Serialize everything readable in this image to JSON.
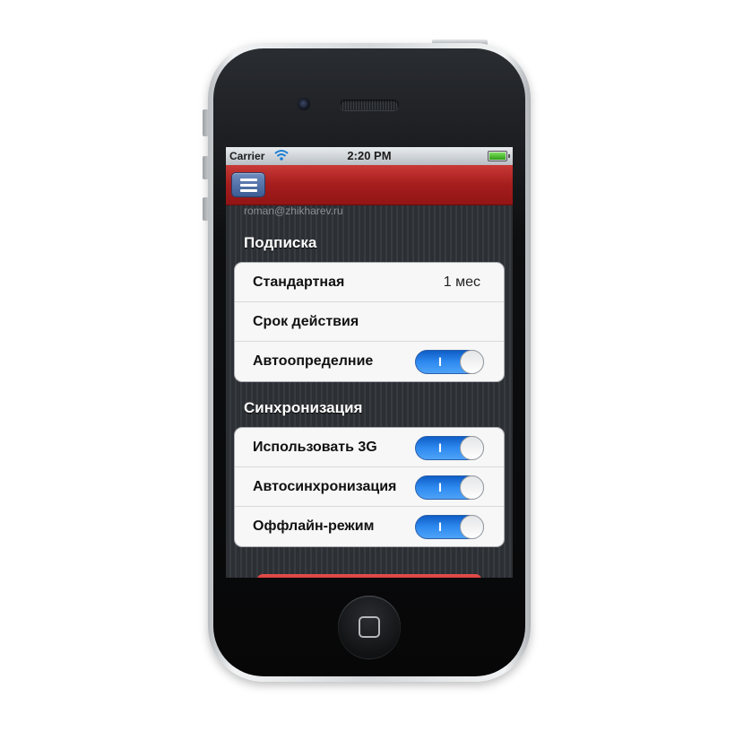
{
  "statusbar": {
    "carrier": "Carrier",
    "time": "2:20 PM"
  },
  "account": {
    "email": "roman@zhikharev.ru"
  },
  "subscription": {
    "title": "Подписка",
    "rows": [
      {
        "label": "Стандартная",
        "value": "1 мес"
      },
      {
        "label": "Срок действия",
        "value": ""
      },
      {
        "label": "Автоопределние",
        "toggle_mark": "I",
        "on": true
      }
    ]
  },
  "sync": {
    "title": "Синхронизация",
    "rows": [
      {
        "label": "Использовать 3G",
        "toggle_mark": "I",
        "on": true
      },
      {
        "label": "Автосинхронизация",
        "toggle_mark": "I",
        "on": true
      },
      {
        "label": "Оффлайн-режим",
        "toggle_mark": "I",
        "on": true
      }
    ]
  },
  "colors": {
    "navbar": "#a51d1d",
    "toggle_on": "#2e8af0",
    "menu_button": "#4f6fa8"
  },
  "icons": {
    "menu": "menu-icon",
    "wifi": "wifi-icon",
    "battery": "battery-icon",
    "home": "home-button-icon"
  }
}
